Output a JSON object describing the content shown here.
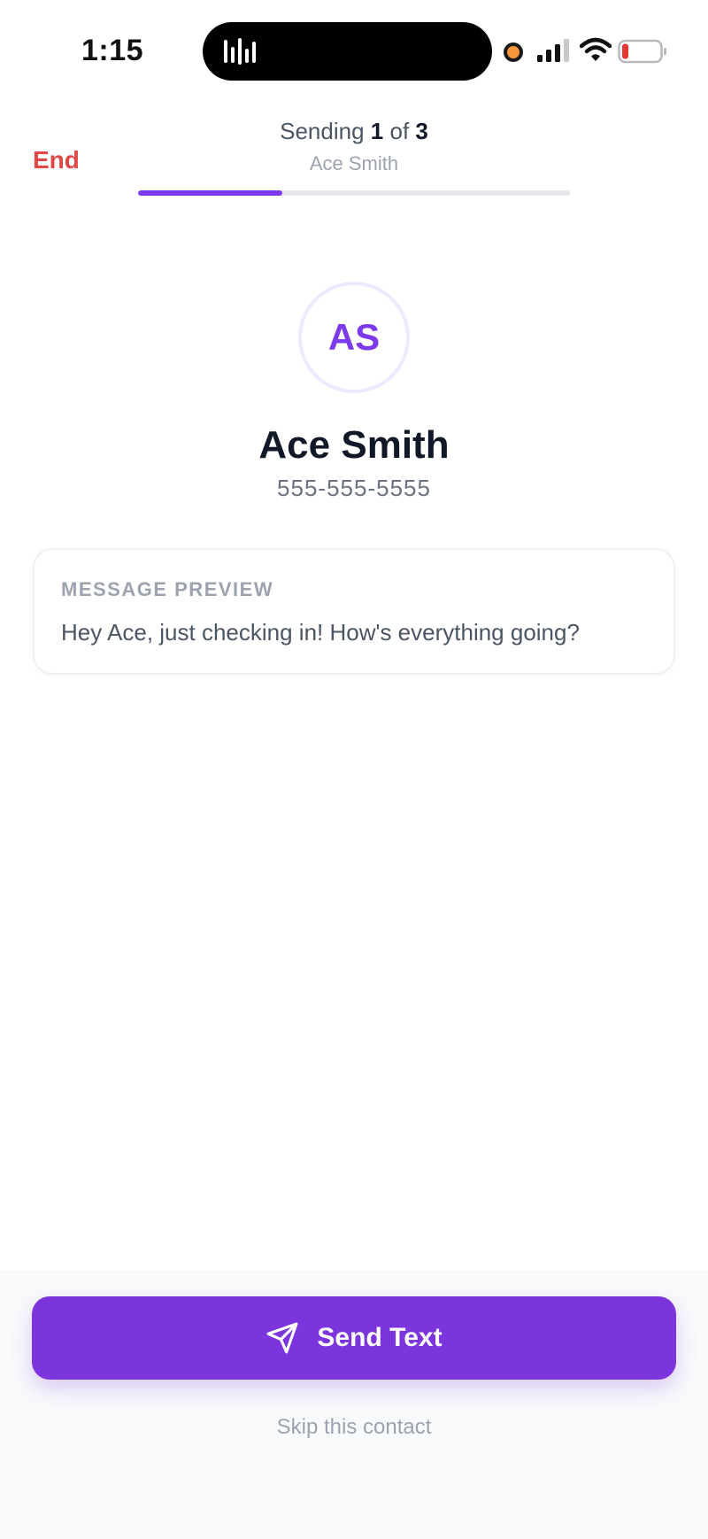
{
  "status_bar": {
    "time": "1:15",
    "icons": [
      "audio-wave-icon",
      "recording-dot-icon",
      "cellular-signal-icon",
      "wifi-icon",
      "battery-low-icon"
    ],
    "colors": {
      "recording": "#f5973a",
      "battery_low": "#e53935"
    }
  },
  "header": {
    "end_label": "End",
    "sending_prefix": "Sending",
    "current": "1",
    "of_label": "of",
    "total": "3",
    "subtitle": "Ace Smith",
    "progress_fraction": 0.333
  },
  "contact": {
    "initials": "AS",
    "name": "Ace Smith",
    "phone": "555-555-5555"
  },
  "message_preview": {
    "label": "MESSAGE PREVIEW",
    "text": "Hey Ace, just checking in! How's everything going?"
  },
  "footer": {
    "send_label": "Send Text",
    "send_icon": "paper-plane-icon",
    "skip_label": "Skip this contact"
  },
  "colors": {
    "accent": "#7c35dc",
    "danger": "#e04848",
    "avatar_ring": "#ede9fe"
  }
}
